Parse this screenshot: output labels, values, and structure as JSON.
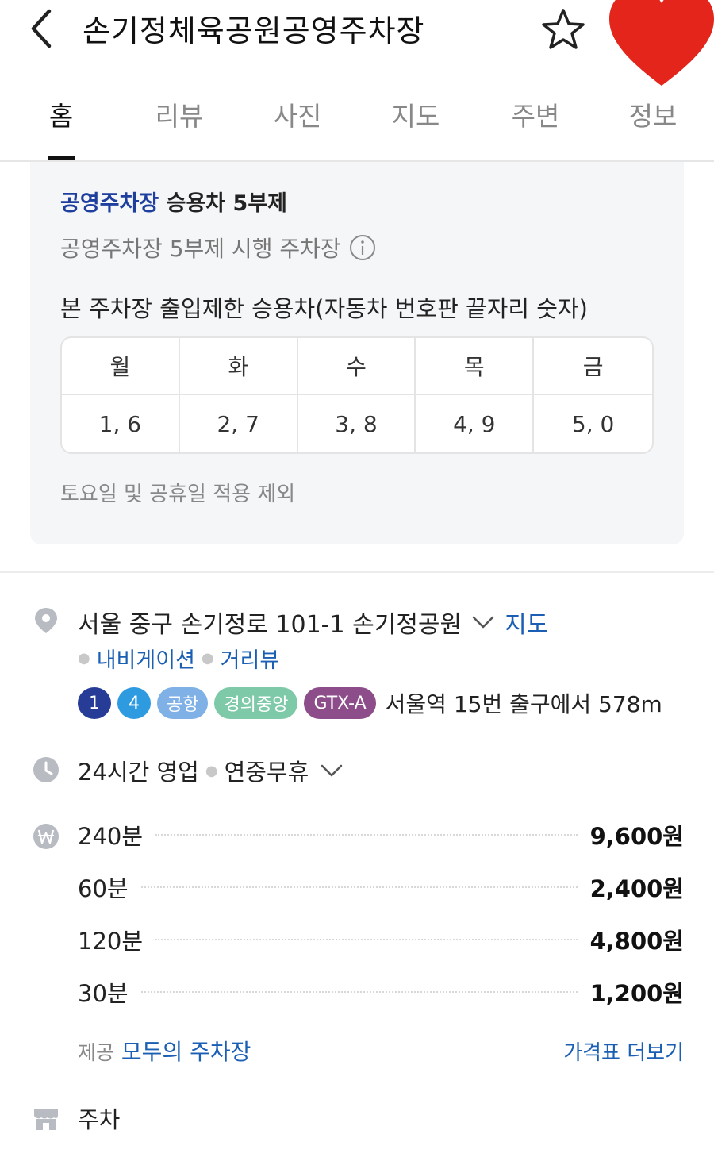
{
  "header": {
    "title": "손기정체육공원공영주차장",
    "colors": {
      "heart": "#e4251b"
    }
  },
  "tabs": [
    {
      "label": "홈"
    },
    {
      "label": "리뷰"
    },
    {
      "label": "사진"
    },
    {
      "label": "지도"
    },
    {
      "label": "주변"
    },
    {
      "label": "정보"
    }
  ],
  "rotation": {
    "head_highlight": "공영주차장",
    "head_rest": "승용차 5부제",
    "sub": "공영주차장 5부제 시행 주차장",
    "desc": "본 주차장 출입제한 승용차(자동차 번호판 끝자리 숫자)",
    "days": [
      "월",
      "화",
      "수",
      "목",
      "금"
    ],
    "digits": [
      "1, 6",
      "2, 7",
      "3, 8",
      "4, 9",
      "5, 0"
    ],
    "note": "토요일 및 공휴일 적용 제외"
  },
  "address": {
    "text": "서울 중구 손기정로 101-1 손기정공원",
    "map_link": "지도",
    "navigation_link": "내비게이션",
    "street_view_link": "거리뷰"
  },
  "subway": {
    "lines": [
      {
        "label": "1",
        "color": "#263c96"
      },
      {
        "label": "4",
        "color": "#2e9be0"
      },
      {
        "label": "공항",
        "color": "#7fb0e6"
      },
      {
        "label": "경의중앙",
        "color": "#7ec9a8"
      },
      {
        "label": "GTX-A",
        "color": "#8d4d8a"
      }
    ],
    "text": "서울역 15번 출구에서 578m"
  },
  "hours": {
    "status": "24시간 영업",
    "holiday": "연중무휴"
  },
  "prices": [
    {
      "label": "240분",
      "value": "9,600원"
    },
    {
      "label": "60분",
      "value": "2,400원"
    },
    {
      "label": "120분",
      "value": "4,800원"
    },
    {
      "label": "30분",
      "value": "1,200원"
    }
  ],
  "provider": {
    "prefix": "제공",
    "name": "모두의 주차장",
    "more": "가격표 더보기"
  },
  "category": {
    "label": "주차"
  }
}
